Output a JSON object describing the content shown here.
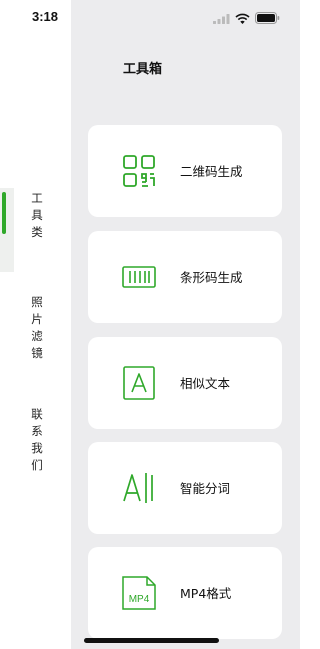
{
  "status_bar": {
    "time": "3:18"
  },
  "sidebar": {
    "items": [
      {
        "label": "工具类",
        "selected": true
      },
      {
        "label": "照片滤镜",
        "selected": false
      },
      {
        "label": "联系我们",
        "selected": false
      }
    ]
  },
  "main": {
    "title": "工具箱",
    "tools": [
      {
        "label": "二维码生成",
        "icon": "qr-code-icon"
      },
      {
        "label": "条形码生成",
        "icon": "barcode-icon"
      },
      {
        "label": "相似文本",
        "icon": "letter-a-icon"
      },
      {
        "label": "智能分词",
        "icon": "ai-segment-icon"
      },
      {
        "label": "MP4格式",
        "icon": "mp4-file-icon",
        "icon_text": "MP4"
      }
    ]
  },
  "colors": {
    "accent": "#2fa82a",
    "background": "#ececee",
    "card": "#ffffff"
  }
}
